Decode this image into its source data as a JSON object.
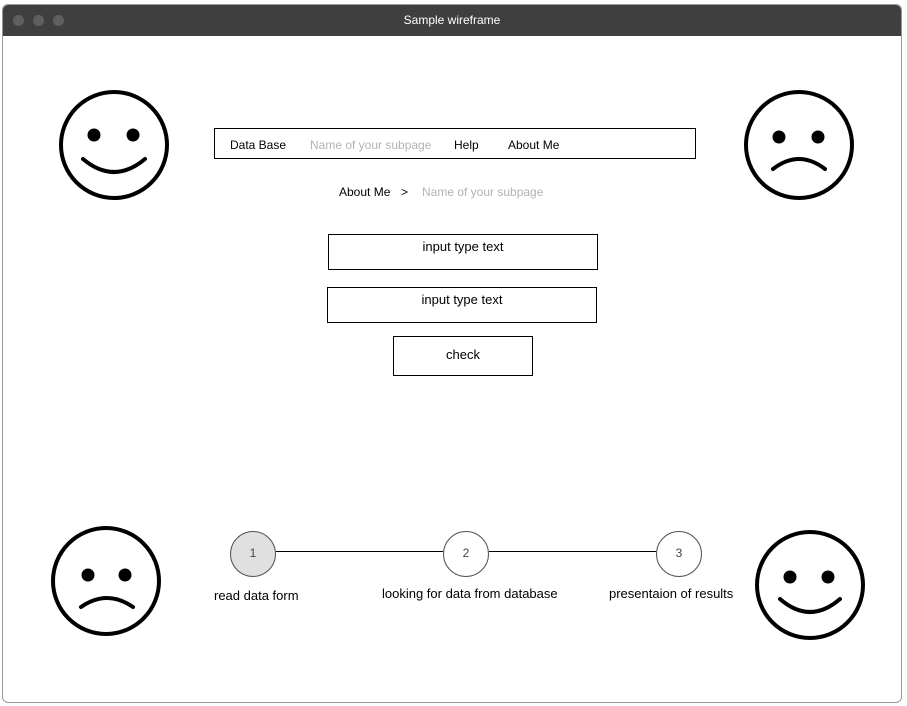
{
  "window": {
    "title": "Sample wireframe"
  },
  "icons": {
    "top_left": "smiley-face-icon",
    "top_right": "sad-face-icon",
    "bottom_left": "sad-face-icon",
    "bottom_right": "smiley-face-icon"
  },
  "nav": {
    "items": [
      {
        "label": "Data Base",
        "muted": false
      },
      {
        "label": "Name of your subpage",
        "muted": true
      },
      {
        "label": "Help",
        "muted": false
      },
      {
        "label": "About Me",
        "muted": false
      }
    ]
  },
  "breadcrumb": {
    "parent": "About Me",
    "separator": ">",
    "current": "Name of your subpage"
  },
  "form": {
    "field1": "input type text",
    "field2": "input type text",
    "check_label": "check"
  },
  "steps": [
    {
      "number": "1",
      "label": "read data form",
      "active": true
    },
    {
      "number": "2",
      "label": "looking for data from database",
      "active": false
    },
    {
      "number": "3",
      "label": "presentaion of results",
      "active": false
    }
  ],
  "colors": {
    "titlebar": "#3f3f3f",
    "active_step": "#e0e0e0",
    "muted_text": "#b3b3b3"
  }
}
